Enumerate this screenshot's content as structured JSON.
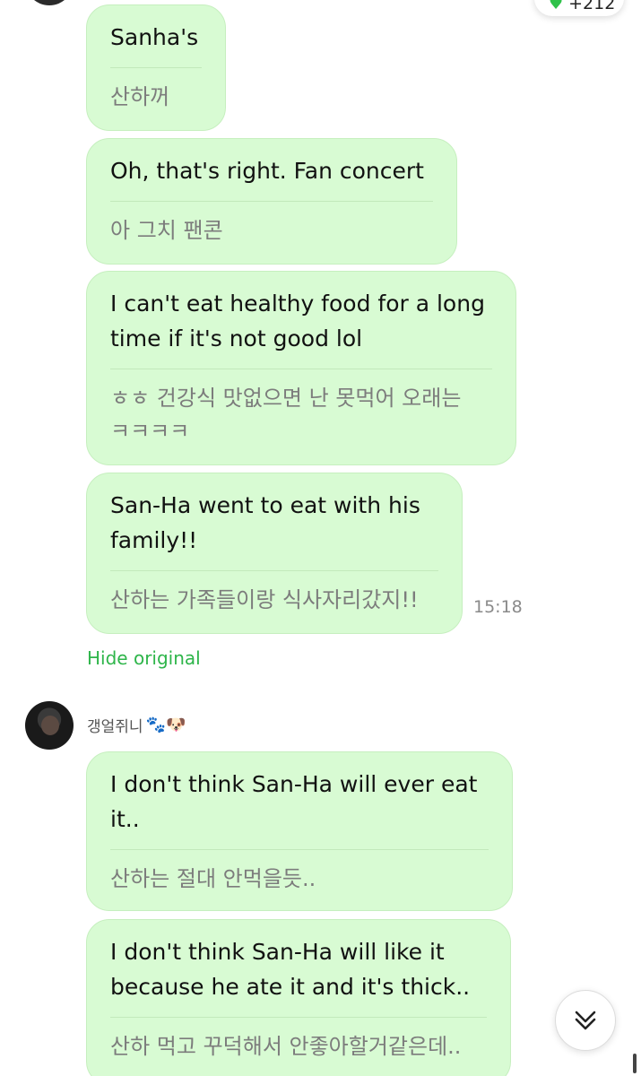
{
  "reaction": {
    "count": "+212",
    "accent": "#2fc24a"
  },
  "messages": [
    {
      "translated": "Sanha's",
      "original": "산하꺼"
    },
    {
      "translated": "Oh, that's right. Fan concert",
      "original": "아 그치 팬콘"
    },
    {
      "translated": "I can't eat healthy food for a long\ntime if it's not good lol",
      "original": "ㅎㅎ 건강식 맛없으면 난 못먹어 오래는\nㅋㅋㅋㅋ"
    },
    {
      "translated": "San-Ha went to eat with his\nfamily!!",
      "original": "산하는 가족들이랑 식사자리갔지!!"
    },
    {
      "translated": "I don't think San-Ha will ever eat\nit..",
      "original": "산하는 절대 안먹을듯.."
    },
    {
      "translated": "I don't think San-Ha will like it\nbecause he ate it and it's thick..",
      "original": "산하 먹고 꾸덕해서 안좋아할거같은데.."
    }
  ],
  "timestamp": "15:18",
  "hide_original_label": "Hide original",
  "sender": {
    "name": "갱얼쥐니",
    "emoji": "🐾🐶"
  },
  "colors": {
    "bubble": "#d8fbd3",
    "link": "#2eb54a"
  },
  "icons": {
    "reaction": "heart-icon",
    "scroll": "double-chevron-down-icon"
  }
}
